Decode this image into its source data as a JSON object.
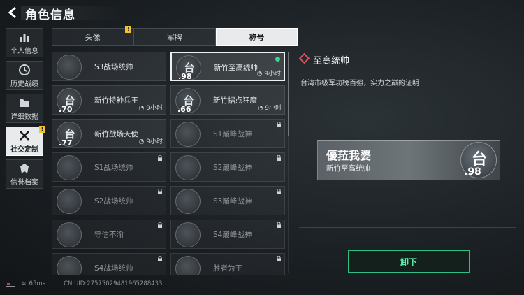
{
  "header": {
    "title": "角色信息"
  },
  "nav": [
    {
      "label": "个人信息",
      "icon": "bar-chart-icon",
      "active": false,
      "badge": ""
    },
    {
      "label": "历史战绩",
      "icon": "clock-icon",
      "active": false,
      "badge": ""
    },
    {
      "label": "详细数据",
      "icon": "folder-icon",
      "active": false,
      "badge": ""
    },
    {
      "label": "社交定制",
      "icon": "tools-icon",
      "active": true,
      "badge": "!"
    },
    {
      "label": "信誉档案",
      "icon": "shield-icon",
      "active": false,
      "badge": ""
    }
  ],
  "tabs": [
    {
      "label": "头像",
      "active": false,
      "badge": "!"
    },
    {
      "label": "军牌",
      "active": false,
      "badge": ""
    },
    {
      "label": "称号",
      "active": true,
      "badge": ""
    }
  ],
  "cards": [
    {
      "name": "S3战场统帅",
      "emblem": "",
      "rank": "",
      "time": "",
      "locked": false,
      "selected": false,
      "equipped": false
    },
    {
      "name": "新竹至高统帅",
      "emblem": "台",
      "rank": ".98",
      "time": "9小时",
      "locked": false,
      "selected": true,
      "equipped": true
    },
    {
      "name": "新竹特种兵王",
      "emblem": "台",
      "rank": ".70",
      "time": "9小时",
      "locked": false,
      "selected": false,
      "equipped": false
    },
    {
      "name": "新竹据点狂魔",
      "emblem": "台",
      "rank": ".66",
      "time": "9小时",
      "locked": false,
      "selected": false,
      "equipped": false
    },
    {
      "name": "新竹战场天使",
      "emblem": "台",
      "rank": ".77",
      "time": "9小时",
      "locked": false,
      "selected": false,
      "equipped": false
    },
    {
      "name": "S1巅峰战神",
      "emblem": "",
      "rank": "",
      "time": "",
      "locked": true,
      "selected": false,
      "equipped": false
    },
    {
      "name": "S1战场统帅",
      "emblem": "",
      "rank": "",
      "time": "",
      "locked": true,
      "selected": false,
      "equipped": false
    },
    {
      "name": "S2巅峰战神",
      "emblem": "",
      "rank": "",
      "time": "",
      "locked": true,
      "selected": false,
      "equipped": false
    },
    {
      "name": "S2战场统帅",
      "emblem": "",
      "rank": "",
      "time": "",
      "locked": true,
      "selected": false,
      "equipped": false
    },
    {
      "name": "S3巅峰战神",
      "emblem": "",
      "rank": "",
      "time": "",
      "locked": true,
      "selected": false,
      "equipped": false
    },
    {
      "name": "守信不渝",
      "emblem": "",
      "rank": "",
      "time": "",
      "locked": true,
      "selected": false,
      "equipped": false
    },
    {
      "name": "S4巅峰战神",
      "emblem": "",
      "rank": "",
      "time": "",
      "locked": true,
      "selected": false,
      "equipped": false
    },
    {
      "name": "S4战场统帅",
      "emblem": "",
      "rank": "",
      "time": "",
      "locked": true,
      "selected": false,
      "equipped": false
    },
    {
      "name": "胜者为王",
      "emblem": "",
      "rank": "",
      "time": "",
      "locked": true,
      "selected": false,
      "equipped": false
    }
  ],
  "detail": {
    "title": "至高统帅",
    "description": "台湾市级军功榜百强，实力之巅的证明！",
    "plate_name": "優菈我婆",
    "plate_title": "新竹至高统帅",
    "plate_emblem": "台",
    "plate_rank": ".98",
    "unequip_label": "卸下"
  },
  "status": {
    "ping": "65ms",
    "uid": "CN UID:2757502948196528​8433"
  },
  "colors": {
    "accent_green": "#58f0a8",
    "badge_yellow": "#f2c230",
    "title_red": "#e0505a"
  }
}
